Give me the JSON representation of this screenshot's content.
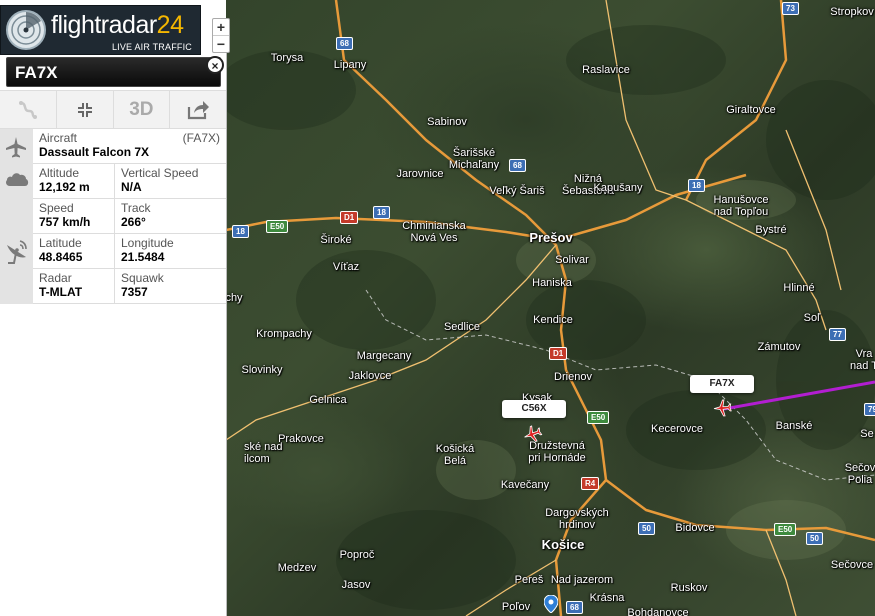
{
  "logo": {
    "text_main": "flightradar",
    "text_num": "24",
    "subtitle": "LIVE AIR TRAFFIC"
  },
  "zoom": {
    "plus": "+",
    "minus": "−"
  },
  "panel": {
    "title": "FA7X",
    "close": "×",
    "tools": {
      "route_icon": "route-icon",
      "collapse_icon": "collapse-icon",
      "view_3d": "3D",
      "share_icon": "share-icon"
    },
    "info": {
      "aircraft_label": "Aircraft",
      "aircraft_code": "(FA7X)",
      "aircraft_value": "Dassault Falcon 7X",
      "altitude_label": "Altitude",
      "altitude_value": "12,192 m",
      "vspeed_label": "Vertical Speed",
      "vspeed_value": "N/A",
      "speed_label": "Speed",
      "speed_value": "757 km/h",
      "track_label": "Track",
      "track_value": "266°",
      "latitude_label": "Latitude",
      "latitude_value": "48.8465",
      "longitude_label": "Longitude",
      "longitude_value": "21.5484",
      "radar_label": "Radar",
      "radar_value": "T-MLAT",
      "squawk_label": "Squawk",
      "squawk_value": "7357"
    }
  },
  "map": {
    "places": {
      "torysa": "Torysa",
      "lipany": "Lipany",
      "raslavice": "Raslavice",
      "stropkov": "Stropkov",
      "sabinov": "Sabinov",
      "sarisske": "Šarišské\nMichaľany",
      "jarovnice": "Jarovnice",
      "velky_saris": "Veľký Šariš",
      "nizna": "Nižná\nŠebastová",
      "kapusany": "Kapušany",
      "giraltovce": "Giraltovce",
      "hanusovce": "Hanušovce\nnad Topľou",
      "siroke": "Široké",
      "chminianska": "Chminianska\nNová Ves",
      "presov": "Prešov",
      "bystre": "Bystré",
      "vitaz": "Víťaz",
      "solivar": "Solivar",
      "haniska": "Haniska",
      "hlinne": "Hlinné",
      "chy": "chy",
      "sedlice": "Sedlice",
      "kendice": "Kendice",
      "sol": "Soľ",
      "krompachy": "Krompachy",
      "zamutov": "Zámutov",
      "vra": "Vra\nnad T",
      "margecany": "Margecany",
      "slovinky": "Slovinky",
      "jaklovce": "Jaklovce",
      "drienov": "Drienov",
      "kysak": "Kysak",
      "gelnica": "Gelnica",
      "kecerovce": "Kecerovce",
      "banske": "Banské",
      "ske_nad": "ské nad\nilcom",
      "prakovce": "Prakovce",
      "kosicka": "Košická\nBelá",
      "druzstevna": "Družstevná\npri Hornáde",
      "se": "Se",
      "secov": "Sečov\nPolia",
      "kavecany": "Kavečany",
      "dargovskych": "Dargovských\nhrdinov",
      "kosice": "Košice",
      "bidovce": "Bidovce",
      "secovce": "Sečovce",
      "poproc": "Poproč",
      "medzev": "Medzev",
      "peres": "Pereš",
      "nad_jazerom": "Nad jazerom",
      "jasov": "Jasov",
      "ruskov": "Ruskov",
      "polov": "Poľov",
      "krasna": "Krásna",
      "bohdanovce": "Bohdanovce"
    },
    "shields": {
      "s68a": "68",
      "s73": "73",
      "s68b": "68",
      "s18a": "18",
      "s18b": "18",
      "s18c": "18",
      "e50a": "E50",
      "d1a": "D1",
      "s77": "77",
      "s79": "79",
      "d1b": "D1",
      "e50b": "E50",
      "r4": "R4",
      "s50a": "50",
      "e50c": "E50",
      "s50b": "50",
      "s68c": "68"
    },
    "flights": {
      "fa7x": "FA7X",
      "c56x": "C56X"
    },
    "colors": {
      "track": "#b21ed1",
      "plane": "#e02020"
    }
  }
}
